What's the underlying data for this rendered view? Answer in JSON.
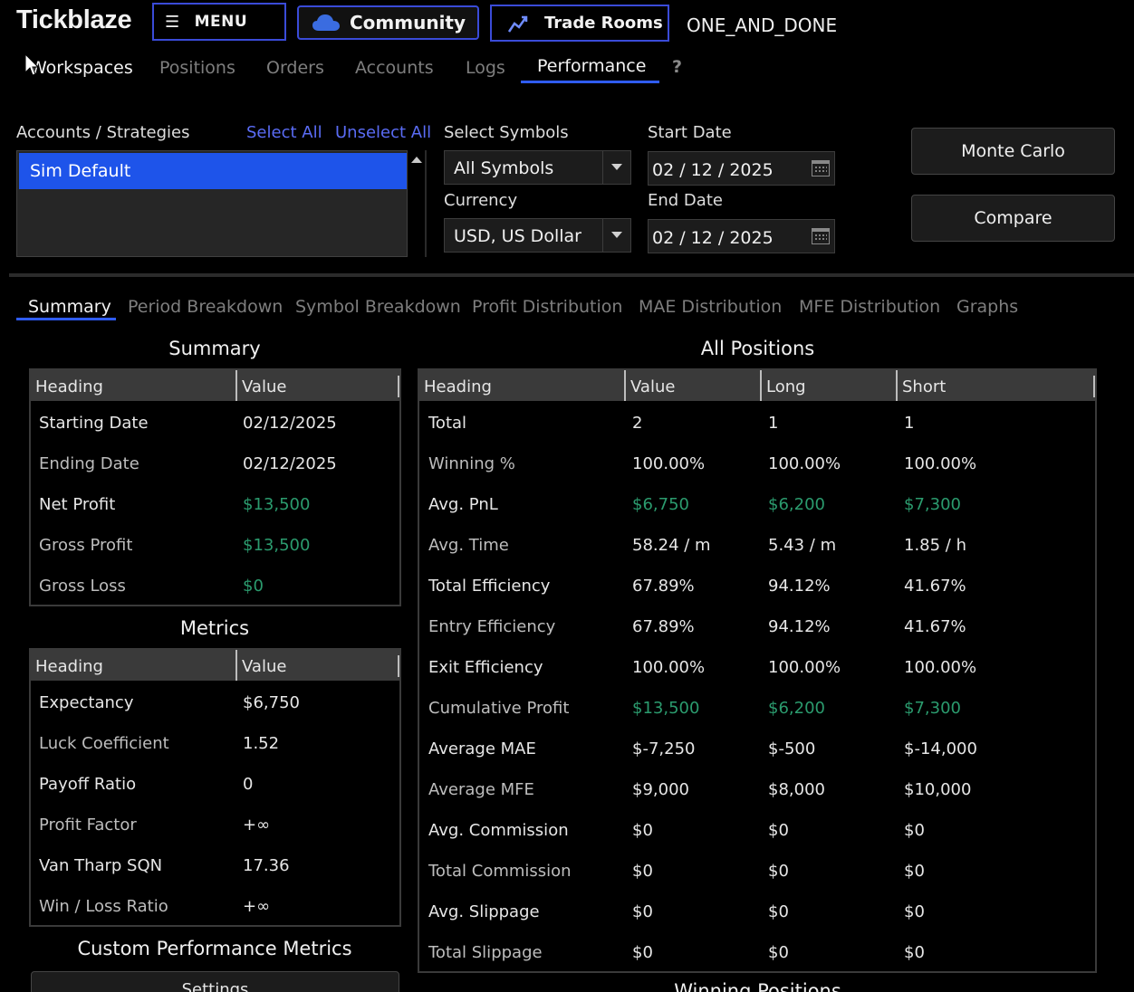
{
  "app": {
    "brand": "Tickblaze",
    "menu_label": "MENU",
    "community_label": "Community",
    "trade_rooms_label": "Trade Rooms",
    "username": "ONE_AND_DONE"
  },
  "nav": {
    "tabs": [
      "Workspaces",
      "Positions",
      "Orders",
      "Accounts",
      "Logs",
      "Performance",
      "?"
    ],
    "active": "Performance"
  },
  "filters": {
    "accounts_label": "Accounts / Strategies",
    "select_all": "Select All",
    "unselect_all": "Unselect All",
    "accounts": [
      "Sim Default"
    ],
    "symbols_label": "Select Symbols",
    "symbols_value": "All Symbols",
    "currency_label": "Currency",
    "currency_value": "USD, US Dollar",
    "start_label": "Start Date",
    "start_value": "02 / 12 / 2025",
    "end_label": "End Date",
    "end_value": "02 / 12 / 2025",
    "monte_carlo": "Monte Carlo",
    "compare": "Compare"
  },
  "subtabs": {
    "items": [
      "Summary",
      "Period Breakdown",
      "Symbol Breakdown",
      "Profit Distribution",
      "MAE Distribution",
      "MFE Distribution",
      "Graphs"
    ],
    "active": "Summary"
  },
  "summary": {
    "title": "Summary",
    "headers": [
      "Heading",
      "Value"
    ],
    "rows": [
      [
        "Starting Date",
        "02/12/2025"
      ],
      [
        "Ending Date",
        "02/12/2025"
      ],
      [
        "Net Profit",
        "$13,500"
      ],
      [
        "Gross Profit",
        "$13,500"
      ],
      [
        "Gross Loss",
        "$0"
      ]
    ]
  },
  "metrics": {
    "title": "Metrics",
    "headers": [
      "Heading",
      "Value"
    ],
    "rows": [
      [
        "Expectancy",
        "$6,750"
      ],
      [
        "Luck Coefficient",
        "1.52"
      ],
      [
        "Payoff Ratio",
        "0"
      ],
      [
        "Profit Factor",
        "+∞"
      ],
      [
        "Van Tharp SQN",
        "17.36"
      ],
      [
        "Win / Loss Ratio",
        "+∞"
      ]
    ]
  },
  "custom": {
    "title": "Custom Performance Metrics",
    "settings": "Settings"
  },
  "all_positions": {
    "title": "All Positions",
    "headers": [
      "Heading",
      "Value",
      "Long",
      "Short"
    ],
    "rows": [
      [
        "Total",
        "2",
        "1",
        "1"
      ],
      [
        "Winning %",
        "100.00%",
        "100.00%",
        "100.00%"
      ],
      [
        "Avg. PnL",
        "$6,750",
        "$6,200",
        "$7,300"
      ],
      [
        "Avg. Time",
        "58.24 / m",
        "5.43 / m",
        "1.85 / h"
      ],
      [
        "Total Efficiency",
        "67.89%",
        "94.12%",
        "41.67%"
      ],
      [
        "Entry Efficiency",
        "67.89%",
        "94.12%",
        "41.67%"
      ],
      [
        "Exit Efficiency",
        "100.00%",
        "100.00%",
        "100.00%"
      ],
      [
        "Cumulative Profit",
        "$13,500",
        "$6,200",
        "$7,300"
      ],
      [
        "Average MAE",
        "$-7,250",
        "$-500",
        "$-14,000"
      ],
      [
        "Average MFE",
        "$9,000",
        "$8,000",
        "$10,000"
      ],
      [
        "Avg. Commission",
        "$0",
        "$0",
        "$0"
      ],
      [
        "Total Commission",
        "$0",
        "$0",
        "$0"
      ],
      [
        "Avg. Slippage",
        "$0",
        "$0",
        "$0"
      ],
      [
        "Total Slippage",
        "$0",
        "$0",
        "$0"
      ]
    ]
  },
  "next_section_title": "Winning Positions",
  "colors": {
    "accent": "#2f5cff",
    "selection": "#1e54ea",
    "profit": "#2b9b6e",
    "link": "#5a6cf5"
  }
}
